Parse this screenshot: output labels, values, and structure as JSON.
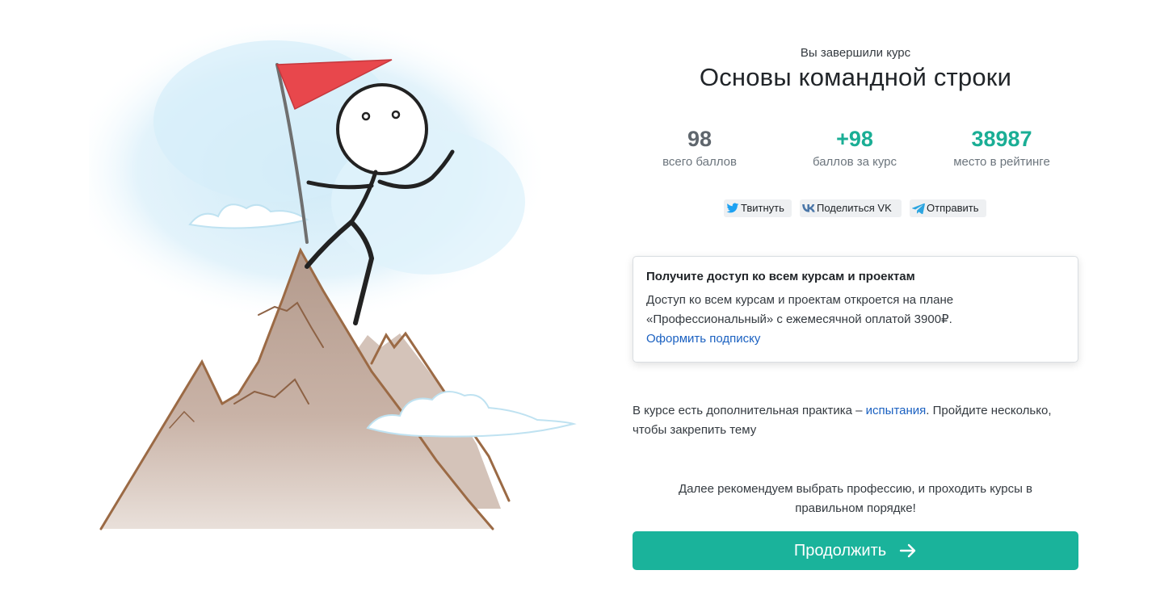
{
  "course": {
    "subtitle": "Вы завершили курс",
    "title": "Основы командной строки"
  },
  "stats": [
    {
      "value": "98",
      "label": "всего баллов",
      "color": "#5f666d"
    },
    {
      "value": "+98",
      "label": "баллов за курс",
      "color": "#1aae95"
    },
    {
      "value": "38987",
      "label": "место в рейтинге",
      "color": "#1aae95"
    }
  ],
  "share": {
    "twitter": {
      "label": "Твитнуть",
      "icon": "twitter-icon"
    },
    "vk": {
      "label": "Поделиться VK",
      "icon": "vk-icon"
    },
    "telegram": {
      "label": "Отправить",
      "icon": "telegram-icon"
    }
  },
  "promo": {
    "title": "Получите доступ ко всем курсам и проектам",
    "text": "Доступ ко всем курсам и проектам откроется на плане «Профессиональный» с ежемесячной оплатой 3900₽.",
    "link": "Оформить подписку"
  },
  "practice": {
    "before": "В курсе есть дополнительная практика – ",
    "link": "испытания",
    "after": ". Пройдите несколько, чтобы закрепить тему"
  },
  "recommend": {
    "line1": "Далее рекомендуем выбрать профессию, и проходить курсы в",
    "line2": "правильном порядке!"
  },
  "continue_button": {
    "label": "Продолжить",
    "icon": "arrow-right-icon"
  },
  "colors": {
    "accent": "#1ab39b",
    "link": "#1b61c1",
    "flag": "#e8474c"
  }
}
